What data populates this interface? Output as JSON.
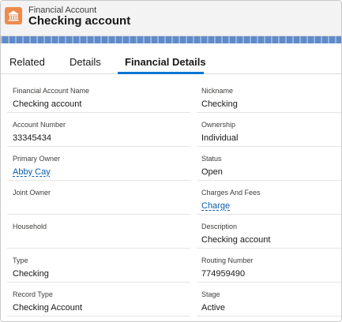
{
  "record": {
    "object_type": "Financial Account",
    "name": "Checking account",
    "icon": "bank-icon"
  },
  "tabs": [
    {
      "label": "Related"
    },
    {
      "label": "Details"
    },
    {
      "label": "Financial Details",
      "active": true
    }
  ],
  "fields": {
    "left": [
      {
        "label": "Financial Account Name",
        "value": "Checking account"
      },
      {
        "label": "Account Number",
        "value": "33345434"
      },
      {
        "label": "Primary Owner",
        "value": "Abby Cay"
      },
      {
        "label": "Joint Owner",
        "value": ""
      },
      {
        "label": "Household",
        "value": ""
      },
      {
        "label": "Type",
        "value": "Checking"
      },
      {
        "label": "Record Type",
        "value": "Checking Account"
      }
    ],
    "right": [
      {
        "label": "Nickname",
        "value": "Checking"
      },
      {
        "label": "Ownership",
        "value": "Individual"
      },
      {
        "label": "Status",
        "value": "Open"
      },
      {
        "label": "Charges And Fees",
        "value": "Charge"
      },
      {
        "label": "Description",
        "value": "Checking account"
      },
      {
        "label": "Routing Number",
        "value": "774959490"
      },
      {
        "label": "Stage",
        "value": "Active"
      }
    ]
  },
  "colors": {
    "accent": "#0176d3",
    "link": "#0b5cab",
    "icon_bg": "#ed8b4d",
    "banner": "#5f8bc9"
  }
}
